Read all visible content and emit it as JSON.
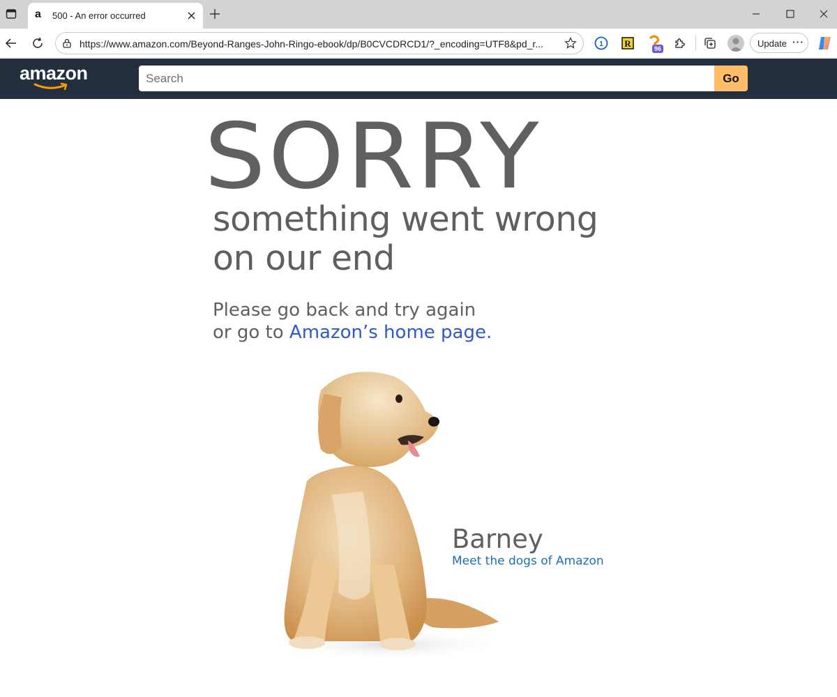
{
  "browser": {
    "tab": {
      "favicon": "a",
      "title": "500 - An error occurred"
    },
    "address": {
      "url": "https://www.amazon.com/Beyond-Ranges-John-Ringo-ebook/dp/B0CVCDRCD1/?_encoding=UTF8&pd_r..."
    },
    "extensions": {
      "badge_count": "96",
      "r_label": "R",
      "onepassword_label": "1"
    },
    "update_label": "Update",
    "more_label": "···"
  },
  "header": {
    "logo_text": "amazon",
    "search_placeholder": "Search",
    "go_label": "Go"
  },
  "error": {
    "headline": "SORRY",
    "subline1": "something went wrong",
    "subline2": "on our end",
    "message_line1": "Please go back and try again",
    "message_line2_prefix": "or go to ",
    "home_link": "Amazon’s home page."
  },
  "dog": {
    "name": "Barney",
    "link": "Meet the dogs of Amazon"
  },
  "colors": {
    "header_bg": "#232f3e",
    "go_button": "#febd69",
    "link_blue": "#2e59c9",
    "dog_link_blue": "#1f6fb5",
    "text_gray": "#5f5f5f"
  }
}
